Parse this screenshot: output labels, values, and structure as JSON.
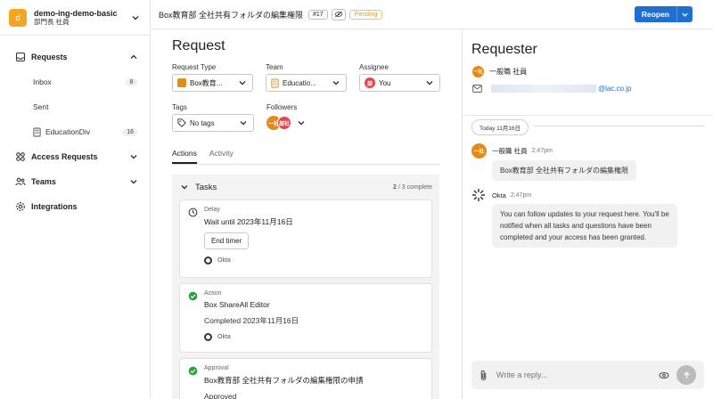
{
  "workspace": {
    "initial": "d",
    "name": "demo-ing-demo-basic",
    "subtitle": "部門長 社員"
  },
  "sidebar": {
    "items": [
      {
        "label": "Requests",
        "icon": "inbox-icon"
      },
      {
        "label": "Access Requests",
        "icon": "key-icon"
      },
      {
        "label": "Teams",
        "icon": "people-icon"
      },
      {
        "label": "Integrations",
        "icon": "gear-icon"
      }
    ],
    "sub_items": [
      {
        "label": "Inbox",
        "count": "8"
      },
      {
        "label": "Sent",
        "count": ""
      },
      {
        "label": "EducationDiv",
        "count": "16"
      }
    ]
  },
  "topbar": {
    "title": "Box教育部 全社共有フォルダの編集権限",
    "number": "#17",
    "status": "Pending",
    "reopen_label": "Reopen"
  },
  "request": {
    "title": "Request",
    "request_type_label": "Request Type",
    "request_type_value": "Box教育...",
    "team_label": "Team",
    "team_value": "Educatio...",
    "assignee_label": "Assignee",
    "assignee_value": "You",
    "assignee_avatar": "部",
    "tags_label": "Tags",
    "tags_value": "No tags",
    "followers_label": "Followers",
    "follower_1": "一社",
    "follower_2": "部社"
  },
  "tabs": [
    {
      "label": "Actions"
    },
    {
      "label": "Activity"
    }
  ],
  "tasks": {
    "title": "Tasks",
    "count_done": "2",
    "count_rest": " / 3 complete",
    "cards": [
      {
        "type": "Delay",
        "title": "Wait until 2023年11月16日",
        "button": "End timer",
        "actor": "Okta"
      },
      {
        "type": "Action",
        "title": "Box ShareAll Editor",
        "sub": "Completed 2023年11月16日",
        "actor": "Okta"
      },
      {
        "type": "Approval",
        "title": "Box教育部 全社共有フォルダの編集権限の申請",
        "sub": "Approved"
      }
    ]
  },
  "requester": {
    "title": "Requester",
    "avatar": "一社",
    "name": "一般職 社員",
    "email_domain": "@lac.co.jp"
  },
  "timeline": {
    "today_label": "Today 11月16日",
    "messages": [
      {
        "author": "一般職 社員",
        "time": "2:47pm",
        "avatar": "一社",
        "text": "Box教育部 全社共有フォルダの編集権限"
      },
      {
        "author": "Okta",
        "time": "2:47pm",
        "text_1": "You can follow updates to your request here. You'll be",
        "text_2": "notified when all tasks and questions have been",
        "text_3": "completed and your access has been granted."
      }
    ]
  },
  "reply": {
    "placeholder": "Write a reply..."
  },
  "colors": {
    "accent": "#1f6fd1",
    "brand": "#f4a623",
    "pending": "#e39a26",
    "success": "#2ea043"
  }
}
